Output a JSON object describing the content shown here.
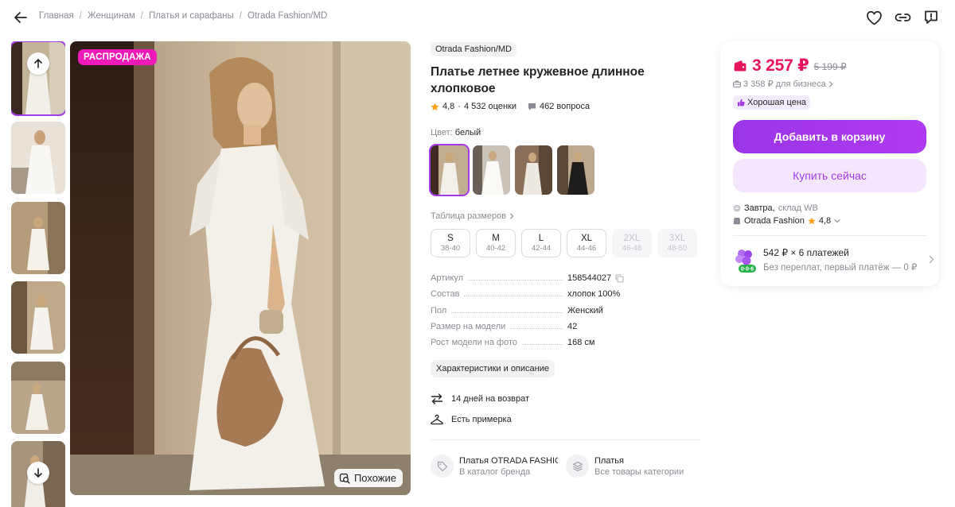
{
  "breadcrumb": [
    "Главная",
    "Женщинам",
    "Платья и сарафаны",
    "Otrada Fashion/MD"
  ],
  "product": {
    "brand": "Otrada Fashion/MD",
    "title": "Платье летнее кружевное длинное хлопковое",
    "rating": "4,8",
    "reviews": "4 532 оценки",
    "questions": "462 вопроса",
    "color_label": "Цвет:",
    "color_value": "белый",
    "size_table": "Таблица размеров",
    "sizes": [
      {
        "label": "S",
        "ru": "38-40",
        "available": true
      },
      {
        "label": "M",
        "ru": "40-42",
        "available": true
      },
      {
        "label": "L",
        "ru": "42-44",
        "available": true
      },
      {
        "label": "XL",
        "ru": "44-46",
        "available": true
      },
      {
        "label": "2XL",
        "ru": "46-48",
        "available": false
      },
      {
        "label": "3XL",
        "ru": "48-50",
        "available": false
      }
    ],
    "specs": [
      {
        "key": "Артикул",
        "value": "158544027"
      },
      {
        "key": "Состав",
        "value": "хлопок 100%"
      },
      {
        "key": "Пол",
        "value": "Женский"
      },
      {
        "key": "Размер на модели",
        "value": "42"
      },
      {
        "key": "Рост модели на фото",
        "value": "168 см"
      }
    ],
    "char_button": "Характеристики и описание",
    "features": [
      "14 дней на возврат",
      "Есть примерка"
    ],
    "categories": [
      {
        "title": "Платья OTRADA FASHION",
        "sub": "В каталог бренда"
      },
      {
        "title": "Платья",
        "sub": "Все товары категории"
      }
    ]
  },
  "media": {
    "sale_badge": "РАСПРОДАЖА",
    "similar": "Похожие"
  },
  "buy": {
    "price": "3 257 ₽",
    "old_price": "5 199 ₽",
    "business_price": "3 358 ₽ для бизнеса",
    "good_price": "Хорошая цена",
    "add_to_cart": "Добавить в корзину",
    "buy_now": "Купить сейчас",
    "delivery_day": "Завтра,",
    "delivery_place": "склад WB",
    "seller_name": "Otrada Fashion",
    "seller_rating": "4,8",
    "installment_title": "542 ₽ × 6 платежей",
    "installment_sub": "Без переплат, первый платёж — 0 ₽"
  },
  "colors": {
    "accent": "#a33be8",
    "price": "#e8155a",
    "sale": "#f01ab8"
  },
  "icons": [
    "arrow-left-icon",
    "heart-icon",
    "link-icon",
    "report-icon",
    "arrow-up-icon",
    "arrow-down-icon",
    "similar-icon",
    "star-icon",
    "questions-icon",
    "chevron-right-icon",
    "copy-icon",
    "return-icon",
    "hanger-icon",
    "tag-icon",
    "layers-icon",
    "wallet-icon",
    "business-icon",
    "thumbs-up-icon",
    "warehouse-icon",
    "shop-icon",
    "installment-icon"
  ]
}
